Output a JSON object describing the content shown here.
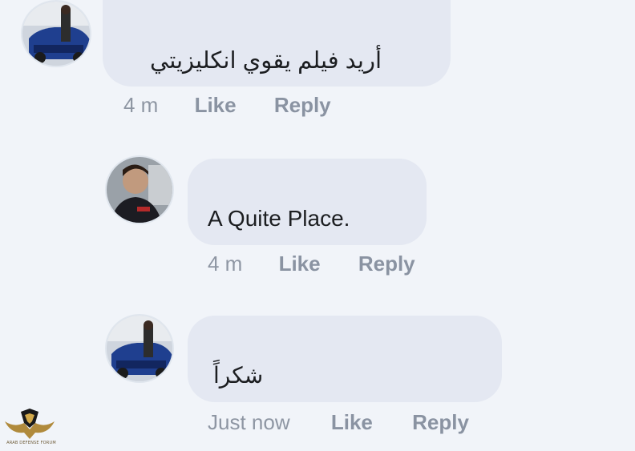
{
  "comments": [
    {
      "text": "أريد فيلم يقوي انكليزيتي",
      "time": "4 m",
      "like": "Like",
      "reply": "Reply"
    },
    {
      "text": "A Quite Place.",
      "time": "4 m",
      "like": "Like",
      "reply": "Reply"
    },
    {
      "text": "شكراً",
      "time": "Just now",
      "like": "Like",
      "reply": "Reply"
    }
  ],
  "watermark": {
    "label": "ARAB DEFENSE FORUM"
  },
  "colors": {
    "page_bg": "#f1f4f9",
    "bubble_bg": "#e4e8f2",
    "meta_text": "#8a93a2",
    "comment_text": "#1c1e21"
  }
}
